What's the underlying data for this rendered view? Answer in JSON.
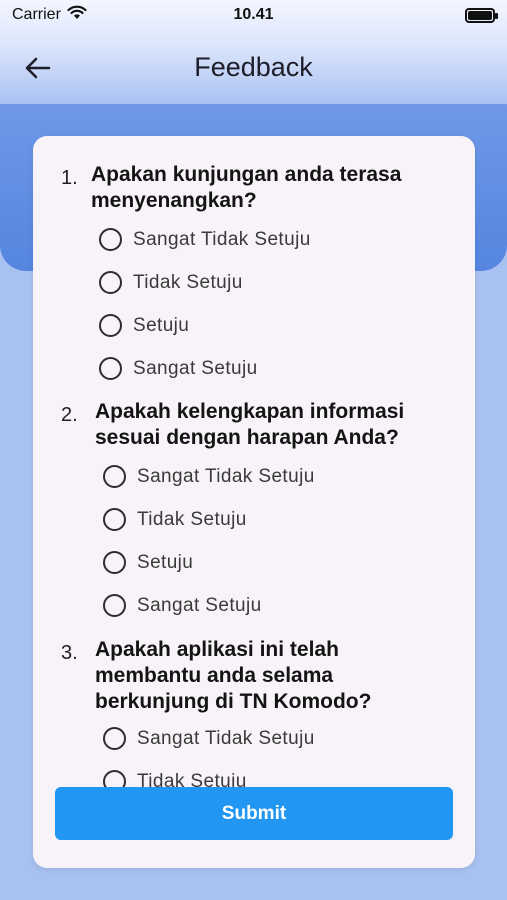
{
  "status_bar": {
    "carrier": "Carrier",
    "time": "10.41"
  },
  "nav": {
    "title": "Feedback"
  },
  "questions": [
    {
      "number": "1.",
      "text": "Apakan kunjungan anda terasa menyenangkan?",
      "options": [
        "Sangat Tidak Setuju",
        "Tidak Setuju",
        "Setuju",
        "Sangat Setuju"
      ]
    },
    {
      "number": "2.",
      "text": "Apakah kelengkapan informasi sesuai dengan harapan Anda?",
      "options": [
        "Sangat Tidak Setuju",
        "Tidak Setuju",
        "Setuju",
        "Sangat Setuju"
      ]
    },
    {
      "number": "3.",
      "text": "Apakah aplikasi ini telah membantu anda selama berkunjung di TN Komodo?",
      "options": [
        "Sangat Tidak Setuju",
        "Tidak Setuju"
      ]
    }
  ],
  "submit_label": "Submit",
  "colors": {
    "primary": "#2196f3",
    "card": "#f7f3f8",
    "background": "#a8c1f0"
  }
}
